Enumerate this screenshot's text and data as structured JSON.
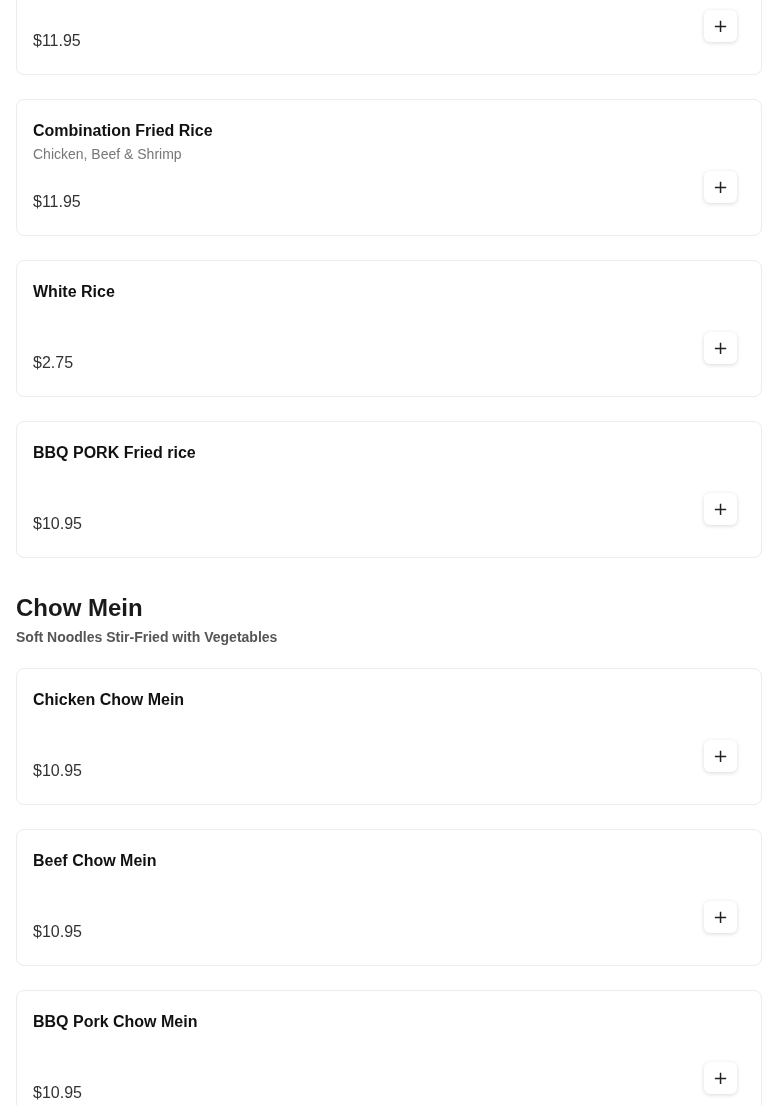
{
  "sections": [
    {
      "items": [
        {
          "price": "$11.95",
          "add": "+"
        },
        {
          "name": "Combination Fried Rice",
          "description": "Chicken, Beef & Shrimp",
          "price": "$11.95",
          "add": "+"
        },
        {
          "name": "White Rice",
          "price": "$2.75",
          "add": "+"
        },
        {
          "name": "BBQ PORK Fried rice",
          "price": "$10.95",
          "add": "+"
        }
      ]
    },
    {
      "title": "Chow Mein",
      "subtitle": "Soft Noodles Stir-Fried with Vegetables",
      "items": [
        {
          "name": "Chicken Chow Mein",
          "price": "$10.95",
          "add": "+"
        },
        {
          "name": "Beef Chow Mein",
          "price": "$10.95",
          "add": "+"
        },
        {
          "name": "BBQ Pork Chow Mein",
          "price": "$10.95",
          "add": "+"
        }
      ]
    }
  ]
}
